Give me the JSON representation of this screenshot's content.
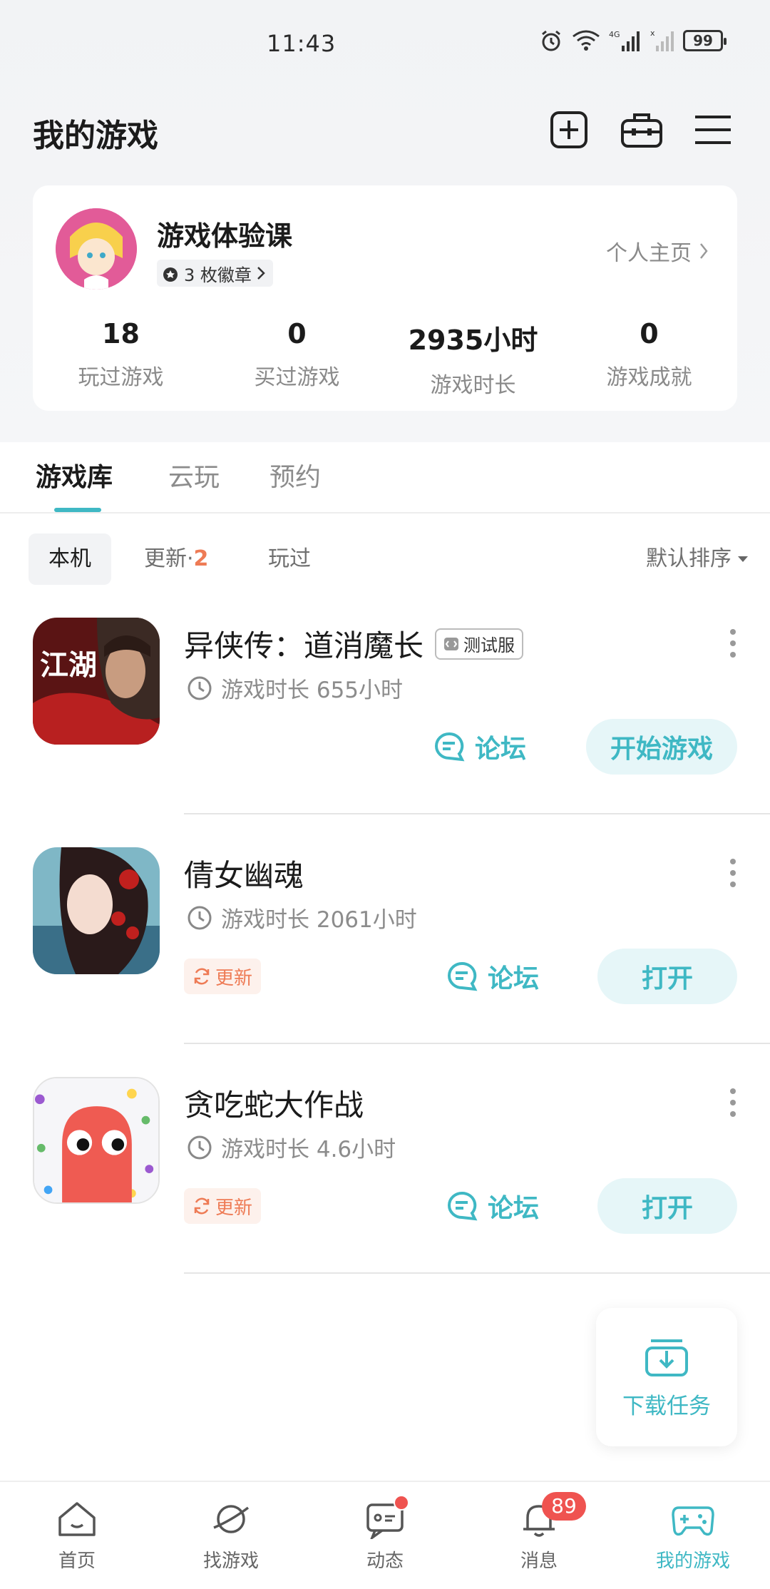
{
  "status_bar": {
    "time": "11:43",
    "battery": "99"
  },
  "header": {
    "title": "我的游戏"
  },
  "profile": {
    "username": "游戏体验课",
    "badges": "3 枚徽章",
    "home_link": "个人主页",
    "stats": [
      {
        "value": "18",
        "label": "玩过游戏"
      },
      {
        "value": "0",
        "label": "买过游戏"
      },
      {
        "value": "2935小时",
        "label": "游戏时长"
      },
      {
        "value": "0",
        "label": "游戏成就"
      }
    ]
  },
  "tabs": [
    "游戏库",
    "云玩",
    "预约"
  ],
  "filters": {
    "local": "本机",
    "update": "更新·",
    "update_count": "2",
    "played": "玩过",
    "sort": "默认排序"
  },
  "games": [
    {
      "name": "异侠传：道消魔长",
      "tag": "测试服",
      "playtime": "游戏时长 655小时",
      "forum": "论坛",
      "action": "开始游戏",
      "icon_text": "江湖"
    },
    {
      "name": "倩女幽魂",
      "update": "更新",
      "playtime": "游戏时长 2061小时",
      "forum": "论坛",
      "action": "打开"
    },
    {
      "name": "贪吃蛇大作战",
      "update": "更新",
      "playtime": "游戏时长 4.6小时",
      "forum": "论坛",
      "action": "打开"
    }
  ],
  "download": {
    "label": "下载任务"
  },
  "bottom_nav": [
    {
      "label": "首页",
      "icon": "home-icon"
    },
    {
      "label": "找游戏",
      "icon": "planet-icon"
    },
    {
      "label": "动态",
      "icon": "chat-icon"
    },
    {
      "label": "消息",
      "icon": "bell-icon",
      "badge": "89"
    },
    {
      "label": "我的游戏",
      "icon": "gamepad-icon"
    }
  ],
  "colors": {
    "accent": "#3fb8c4",
    "update": "#ee7b55",
    "badge": "#ef5350"
  }
}
